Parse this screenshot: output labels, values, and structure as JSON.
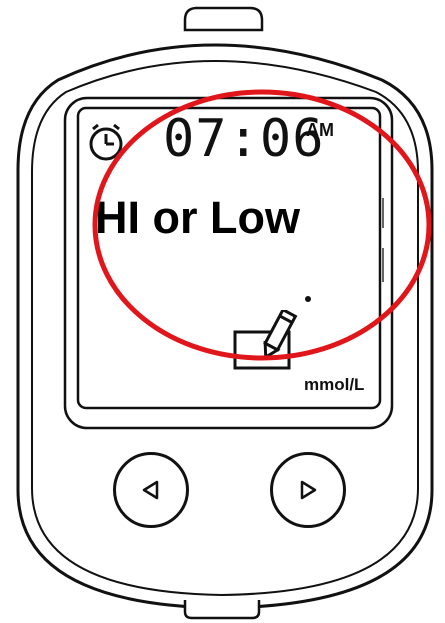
{
  "display": {
    "time": "07:06",
    "ampm": "AM",
    "message": "HI or Low",
    "unit": "mmol/L"
  },
  "icons": {
    "clock": "clock-icon",
    "memo": "memo-pencil-icon",
    "left_button": "left-arrow-icon",
    "right_button": "right-arrow-icon"
  },
  "colors": {
    "highlight_ring": "#e0161b",
    "outline": "#111111"
  }
}
